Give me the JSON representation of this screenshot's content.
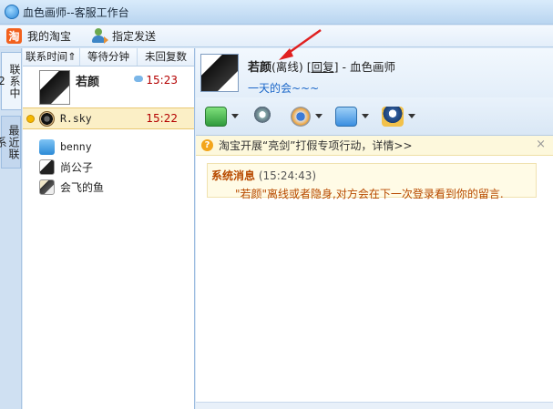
{
  "window": {
    "title": "血色画师--客服工作台"
  },
  "toolbar": {
    "taobao_label": "我的淘宝",
    "send_label": "指定发送"
  },
  "vtabs": {
    "contacts_label": "联系中2",
    "recent_label": "最近联系"
  },
  "sort_tabs": [
    "联系时间⇑",
    "等待分钟",
    "未回复数"
  ],
  "contacts": [
    {
      "name": "若颜",
      "time": "15:23"
    },
    {
      "name": "R.sky",
      "time": "15:22"
    },
    {
      "name": "benny",
      "time": ""
    },
    {
      "name": "尚公子",
      "time": ""
    },
    {
      "name": "会飞的鱼",
      "time": ""
    }
  ],
  "chat": {
    "name": "若颜",
    "status": "(离线)",
    "reply_link": "[回复]",
    "separator": " - ",
    "account": "血色画师",
    "signature": "一天的会~~~"
  },
  "notice": {
    "text": "淘宝开展“亮剑”打假专项行动，详情>>",
    "close": "×"
  },
  "system_message": {
    "title": "系统消息",
    "time": "(15:24:43)",
    "body": "\"若颜\"离线或者隐身,对方会在下一次登录看到你的留言."
  },
  "icons": {
    "tb_taobao": "taobao-icon",
    "tb_send": "user-send-icon",
    "file": "file-transfer-icon",
    "mic": "microphone-icon",
    "cam": "webcam-icon",
    "screen": "remote-screen-icon",
    "service": "customer-service-icon"
  },
  "colors": {
    "time_red": "#b40000",
    "system_orange": "#b84a00",
    "link_blue": "#1a66c8",
    "annotation_red": "#e02020"
  }
}
